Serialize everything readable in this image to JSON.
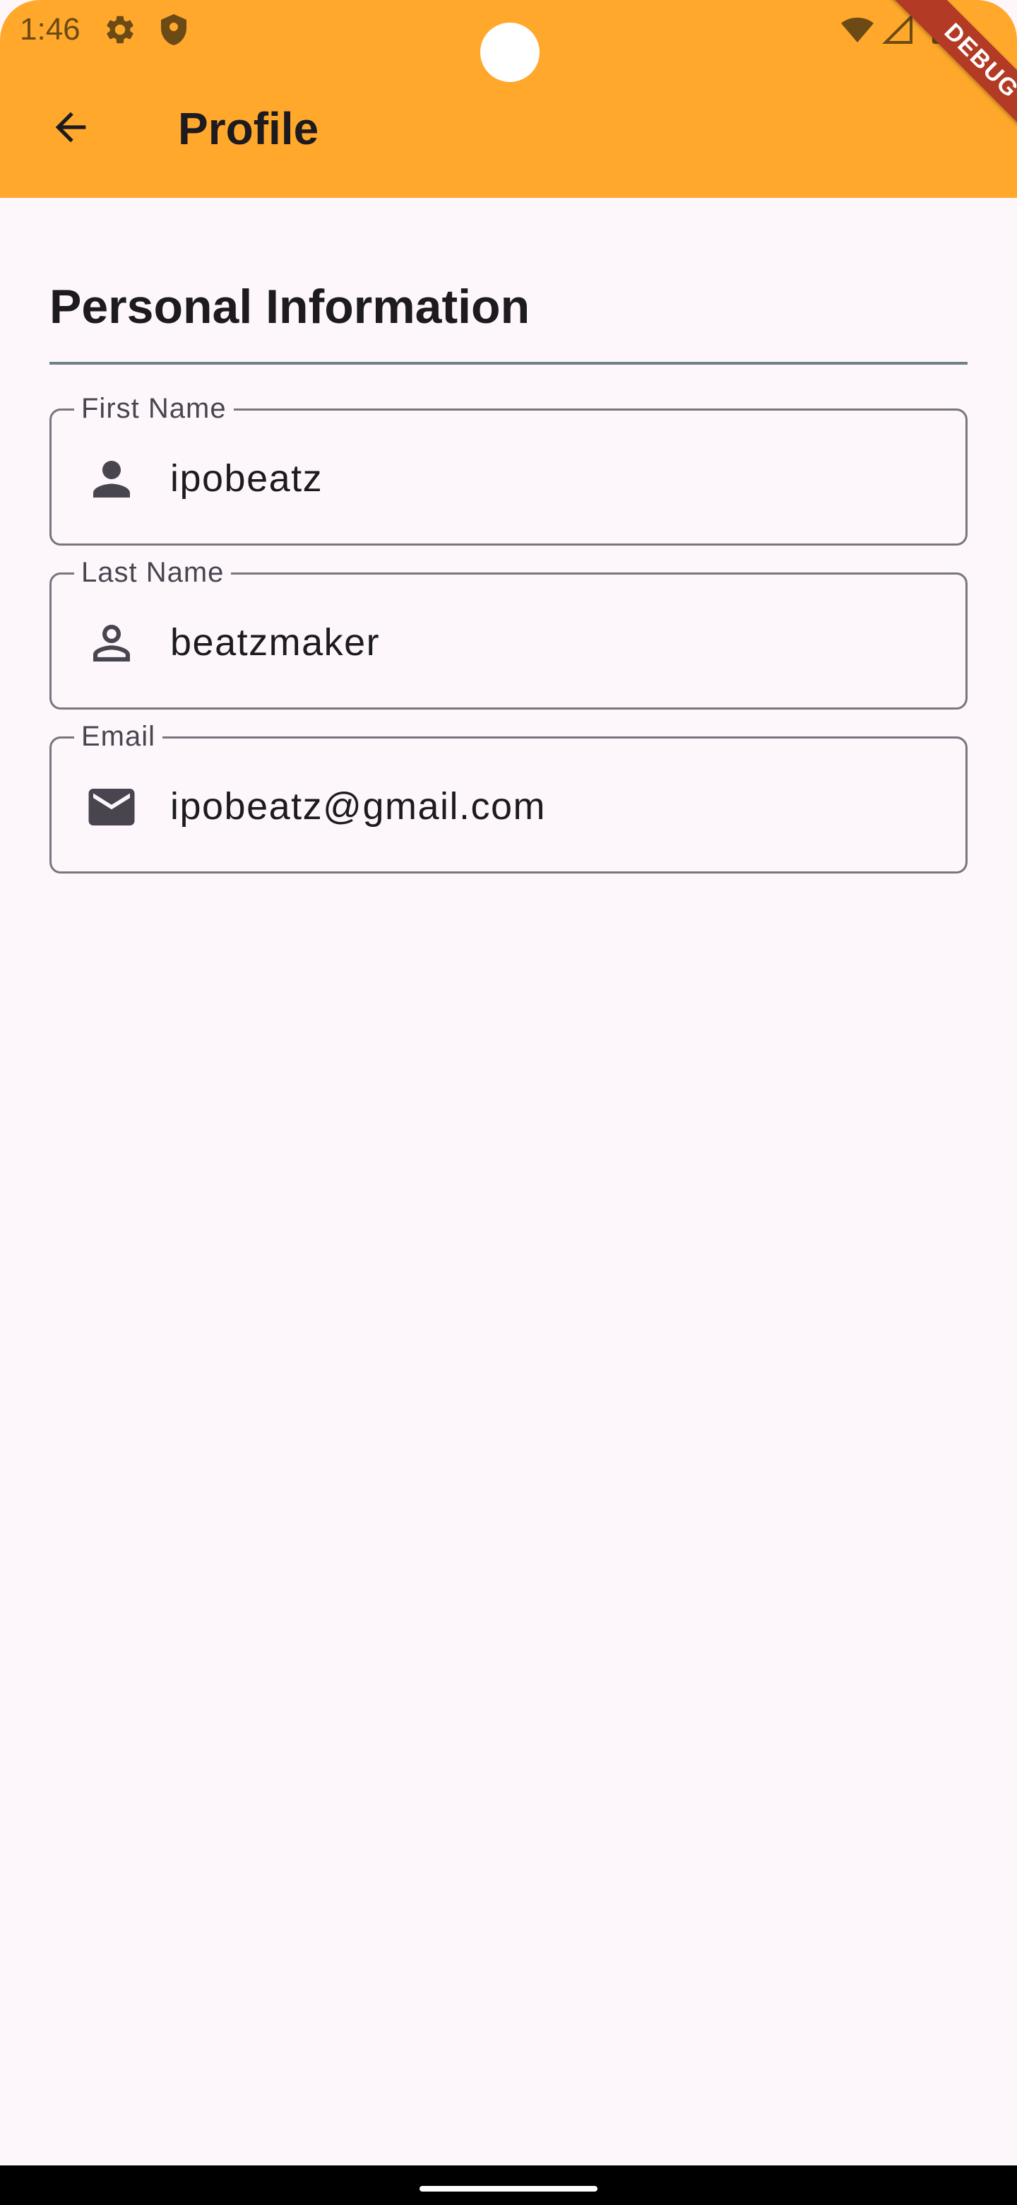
{
  "status_bar": {
    "time": "1:46",
    "icons": [
      "settings-icon",
      "shield-icon",
      "wifi-icon",
      "signal-icon",
      "battery-icon"
    ]
  },
  "app_bar": {
    "title": "Profile",
    "back_icon": "arrow-back-icon",
    "background_color": "#ffa82c"
  },
  "debug_banner": {
    "label": "DEBUG"
  },
  "personal_info": {
    "heading": "Personal Information",
    "fields": [
      {
        "label": "First Name",
        "value": "ipobeatz",
        "icon": "person-filled-icon"
      },
      {
        "label": "Last Name",
        "value": "beatzmaker",
        "icon": "person-outline-icon"
      },
      {
        "label": "Email",
        "value": "ipobeatz@gmail.com",
        "icon": "mail-icon"
      }
    ]
  }
}
